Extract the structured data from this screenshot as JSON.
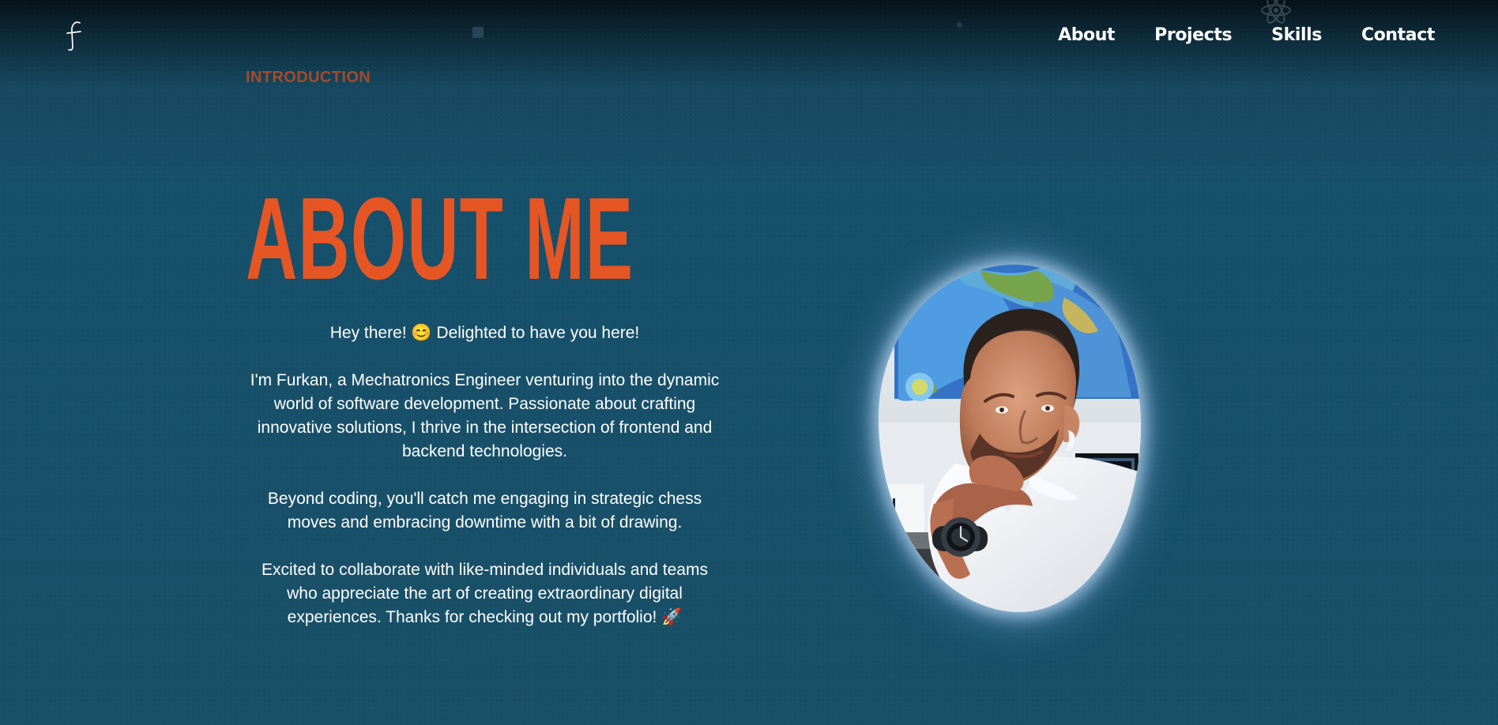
{
  "brand": {
    "logo_text": "f"
  },
  "nav": {
    "items": [
      {
        "label": "About"
      },
      {
        "label": "Projects"
      },
      {
        "label": "Skills"
      },
      {
        "label": "Contact"
      }
    ]
  },
  "hero": {
    "eyebrow": "INTRODUCTION",
    "title": "ABOUT ME"
  },
  "about": {
    "paragraphs": [
      "Hey there! 😊 Delighted to have you here!",
      "I'm Furkan, a Mechatronics Engineer venturing into the dynamic world of software development. Passionate about crafting innovative solutions, I thrive in the intersection of frontend and backend technologies.",
      "Beyond coding, you'll catch me engaging in strategic chess moves and embracing downtime with a bit of drawing.",
      "Excited to collaborate with like-minded individuals and teams who appreciate the art of creating extraordinary digital experiences. Thanks for checking out my portfolio! 🚀"
    ]
  },
  "icons": {
    "logo": "script-f-logo-icon",
    "decoration": "atom-icon",
    "portrait": "profile-portrait"
  },
  "colors": {
    "background": "#17506A",
    "accent": "#E65624",
    "eyebrow": "#A74A2A",
    "text": "#FFFFFF",
    "glow": "#C7E1FF"
  }
}
